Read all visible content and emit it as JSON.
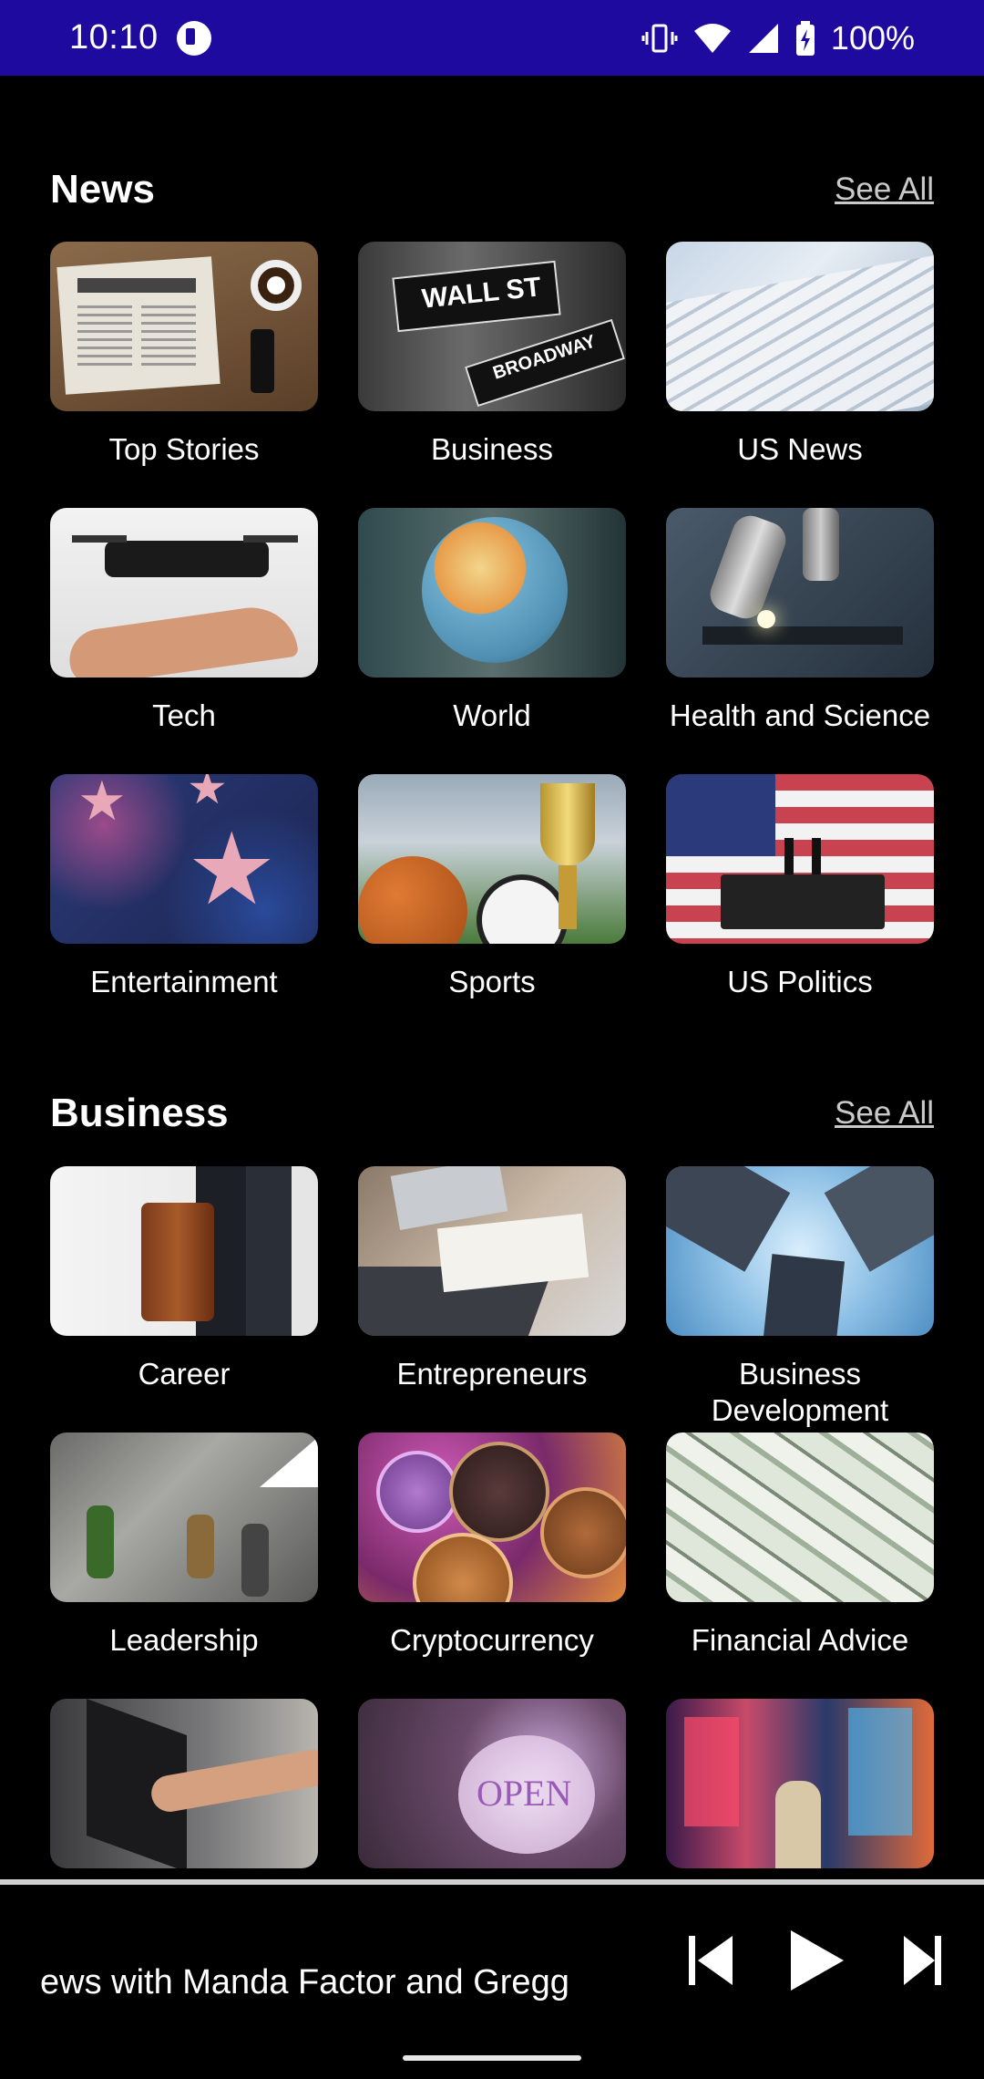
{
  "status_bar": {
    "time": "10:10",
    "battery": "100%",
    "icons": [
      "vibrate-icon",
      "wifi-icon",
      "signal-icon",
      "battery-charging-icon"
    ]
  },
  "sections": [
    {
      "title": "News",
      "see_all": "See All",
      "tiles": [
        {
          "label": "Top Stories",
          "image": "newspaper-coffee-image"
        },
        {
          "label": "Business",
          "image": "wall-street-sign-image"
        },
        {
          "label": "US News",
          "image": "newspapers-stack-image"
        },
        {
          "label": "Tech",
          "image": "drone-hand-image"
        },
        {
          "label": "World",
          "image": "globe-image"
        },
        {
          "label": "Health and Science",
          "image": "microscope-image"
        },
        {
          "label": "Entertainment",
          "image": "walk-of-fame-stars-image"
        },
        {
          "label": "Sports",
          "image": "sports-balls-trophy-image"
        },
        {
          "label": "US Politics",
          "image": "us-flag-podium-image"
        }
      ]
    },
    {
      "title": "Business",
      "see_all": "See All",
      "tiles": [
        {
          "label": "Career",
          "image": "briefcase-walking-image"
        },
        {
          "label": "Entrepreneurs",
          "image": "laptop-desk-writing-image"
        },
        {
          "label": "Business Development",
          "image": "skyscrapers-image"
        },
        {
          "label": "Leadership",
          "image": "mountain-climbers-image"
        },
        {
          "label": "Cryptocurrency",
          "image": "crypto-coins-image"
        },
        {
          "label": "Financial Advice",
          "image": "dollar-bills-image"
        },
        {
          "label": "",
          "image": "laptop-pointing-image"
        },
        {
          "label": "",
          "image": "open-sign-image"
        },
        {
          "label": "",
          "image": "times-square-image"
        }
      ]
    }
  ],
  "player": {
    "now_playing": "ews with Manda Factor and Gregg",
    "controls": [
      "skip-previous-icon",
      "play-icon",
      "skip-next-icon"
    ]
  },
  "colors": {
    "status_bar": "#1e0a9e",
    "background": "#000000",
    "see_all": "#c9c9c9"
  }
}
